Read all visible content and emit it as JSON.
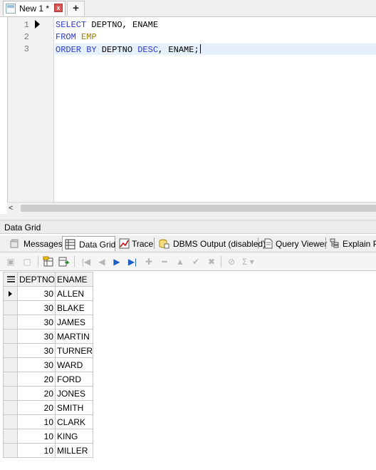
{
  "document_tab": {
    "title": "New 1 *",
    "close": "x",
    "new_tab": "+"
  },
  "editor": {
    "line_numbers": [
      "1",
      "2",
      "3"
    ],
    "lines": [
      [
        {
          "t": "SELECT",
          "c": "kw"
        },
        {
          "t": " DEPTNO, ENAME",
          "c": "txt"
        }
      ],
      [
        {
          "t": "FROM",
          "c": "kw"
        },
        {
          "t": " ",
          "c": "txt"
        },
        {
          "t": "EMP",
          "c": "tbl"
        }
      ],
      [
        {
          "t": "ORDER BY",
          "c": "kw"
        },
        {
          "t": " DEPTNO ",
          "c": "txt"
        },
        {
          "t": "DESC",
          "c": "kw"
        },
        {
          "t": ", ENAME;",
          "c": "txt"
        }
      ]
    ]
  },
  "scrollbar": {
    "left_arrow": "<"
  },
  "panel": {
    "title": "Data Grid"
  },
  "result_tabs": [
    {
      "label": "Messages",
      "icon": "messages-icon"
    },
    {
      "label": "Data Grid",
      "icon": "data-grid-icon",
      "active": true
    },
    {
      "label": "Trace",
      "icon": "trace-icon"
    },
    {
      "label": "DBMS Output (disabled)",
      "icon": "dbms-output-icon"
    },
    {
      "label": "Query Viewer",
      "icon": "query-viewer-icon"
    },
    {
      "label": "Explain Pl",
      "icon": "explain-plan-icon"
    }
  ],
  "grid": {
    "columns": [
      "DEPTNO",
      "ENAME"
    ],
    "rows": [
      [
        "30",
        "ALLEN"
      ],
      [
        "30",
        "BLAKE"
      ],
      [
        "30",
        "JAMES"
      ],
      [
        "30",
        "MARTIN"
      ],
      [
        "30",
        "TURNER"
      ],
      [
        "30",
        "WARD"
      ],
      [
        "20",
        "FORD"
      ],
      [
        "20",
        "JONES"
      ],
      [
        "20",
        "SMITH"
      ],
      [
        "10",
        "CLARK"
      ],
      [
        "10",
        "KING"
      ],
      [
        "10",
        "MILLER"
      ]
    ]
  }
}
